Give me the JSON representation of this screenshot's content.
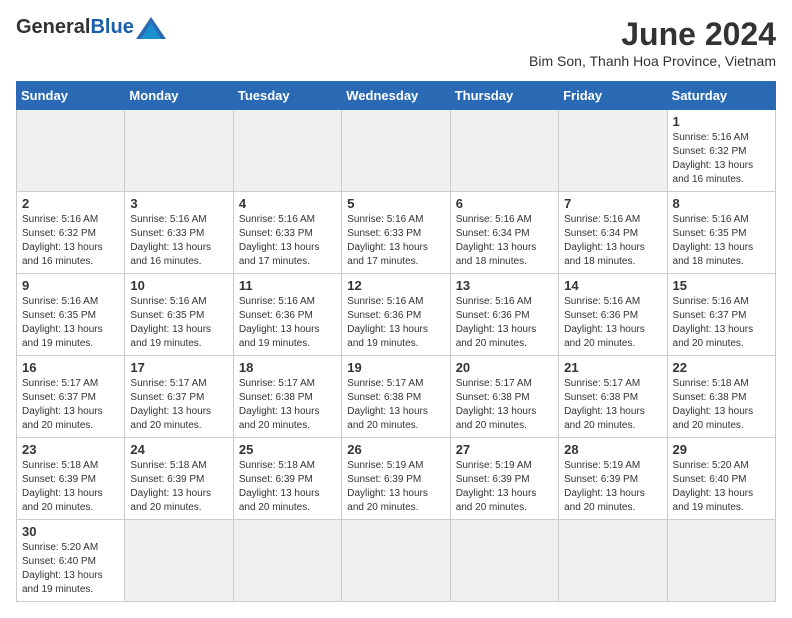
{
  "header": {
    "logo_text_general": "General",
    "logo_text_blue": "Blue",
    "month_year": "June 2024",
    "location": "Bim Son, Thanh Hoa Province, Vietnam"
  },
  "days_of_week": [
    "Sunday",
    "Monday",
    "Tuesday",
    "Wednesday",
    "Thursday",
    "Friday",
    "Saturday"
  ],
  "weeks": [
    [
      {
        "day": "",
        "info": ""
      },
      {
        "day": "",
        "info": ""
      },
      {
        "day": "",
        "info": ""
      },
      {
        "day": "",
        "info": ""
      },
      {
        "day": "",
        "info": ""
      },
      {
        "day": "",
        "info": ""
      },
      {
        "day": "1",
        "info": "Sunrise: 5:16 AM\nSunset: 6:32 PM\nDaylight: 13 hours and 16 minutes."
      }
    ],
    [
      {
        "day": "2",
        "info": "Sunrise: 5:16 AM\nSunset: 6:32 PM\nDaylight: 13 hours and 16 minutes."
      },
      {
        "day": "3",
        "info": "Sunrise: 5:16 AM\nSunset: 6:33 PM\nDaylight: 13 hours and 16 minutes."
      },
      {
        "day": "4",
        "info": "Sunrise: 5:16 AM\nSunset: 6:33 PM\nDaylight: 13 hours and 17 minutes."
      },
      {
        "day": "5",
        "info": "Sunrise: 5:16 AM\nSunset: 6:33 PM\nDaylight: 13 hours and 17 minutes."
      },
      {
        "day": "6",
        "info": "Sunrise: 5:16 AM\nSunset: 6:34 PM\nDaylight: 13 hours and 18 minutes."
      },
      {
        "day": "7",
        "info": "Sunrise: 5:16 AM\nSunset: 6:34 PM\nDaylight: 13 hours and 18 minutes."
      },
      {
        "day": "8",
        "info": "Sunrise: 5:16 AM\nSunset: 6:35 PM\nDaylight: 13 hours and 18 minutes."
      }
    ],
    [
      {
        "day": "9",
        "info": "Sunrise: 5:16 AM\nSunset: 6:35 PM\nDaylight: 13 hours and 19 minutes."
      },
      {
        "day": "10",
        "info": "Sunrise: 5:16 AM\nSunset: 6:35 PM\nDaylight: 13 hours and 19 minutes."
      },
      {
        "day": "11",
        "info": "Sunrise: 5:16 AM\nSunset: 6:36 PM\nDaylight: 13 hours and 19 minutes."
      },
      {
        "day": "12",
        "info": "Sunrise: 5:16 AM\nSunset: 6:36 PM\nDaylight: 13 hours and 19 minutes."
      },
      {
        "day": "13",
        "info": "Sunrise: 5:16 AM\nSunset: 6:36 PM\nDaylight: 13 hours and 20 minutes."
      },
      {
        "day": "14",
        "info": "Sunrise: 5:16 AM\nSunset: 6:36 PM\nDaylight: 13 hours and 20 minutes."
      },
      {
        "day": "15",
        "info": "Sunrise: 5:16 AM\nSunset: 6:37 PM\nDaylight: 13 hours and 20 minutes."
      }
    ],
    [
      {
        "day": "16",
        "info": "Sunrise: 5:17 AM\nSunset: 6:37 PM\nDaylight: 13 hours and 20 minutes."
      },
      {
        "day": "17",
        "info": "Sunrise: 5:17 AM\nSunset: 6:37 PM\nDaylight: 13 hours and 20 minutes."
      },
      {
        "day": "18",
        "info": "Sunrise: 5:17 AM\nSunset: 6:38 PM\nDaylight: 13 hours and 20 minutes."
      },
      {
        "day": "19",
        "info": "Sunrise: 5:17 AM\nSunset: 6:38 PM\nDaylight: 13 hours and 20 minutes."
      },
      {
        "day": "20",
        "info": "Sunrise: 5:17 AM\nSunset: 6:38 PM\nDaylight: 13 hours and 20 minutes."
      },
      {
        "day": "21",
        "info": "Sunrise: 5:17 AM\nSunset: 6:38 PM\nDaylight: 13 hours and 20 minutes."
      },
      {
        "day": "22",
        "info": "Sunrise: 5:18 AM\nSunset: 6:38 PM\nDaylight: 13 hours and 20 minutes."
      }
    ],
    [
      {
        "day": "23",
        "info": "Sunrise: 5:18 AM\nSunset: 6:39 PM\nDaylight: 13 hours and 20 minutes."
      },
      {
        "day": "24",
        "info": "Sunrise: 5:18 AM\nSunset: 6:39 PM\nDaylight: 13 hours and 20 minutes."
      },
      {
        "day": "25",
        "info": "Sunrise: 5:18 AM\nSunset: 6:39 PM\nDaylight: 13 hours and 20 minutes."
      },
      {
        "day": "26",
        "info": "Sunrise: 5:19 AM\nSunset: 6:39 PM\nDaylight: 13 hours and 20 minutes."
      },
      {
        "day": "27",
        "info": "Sunrise: 5:19 AM\nSunset: 6:39 PM\nDaylight: 13 hours and 20 minutes."
      },
      {
        "day": "28",
        "info": "Sunrise: 5:19 AM\nSunset: 6:39 PM\nDaylight: 13 hours and 20 minutes."
      },
      {
        "day": "29",
        "info": "Sunrise: 5:20 AM\nSunset: 6:40 PM\nDaylight: 13 hours and 19 minutes."
      }
    ],
    [
      {
        "day": "30",
        "info": "Sunrise: 5:20 AM\nSunset: 6:40 PM\nDaylight: 13 hours and 19 minutes."
      },
      {
        "day": "",
        "info": ""
      },
      {
        "day": "",
        "info": ""
      },
      {
        "day": "",
        "info": ""
      },
      {
        "day": "",
        "info": ""
      },
      {
        "day": "",
        "info": ""
      },
      {
        "day": "",
        "info": ""
      }
    ]
  ]
}
